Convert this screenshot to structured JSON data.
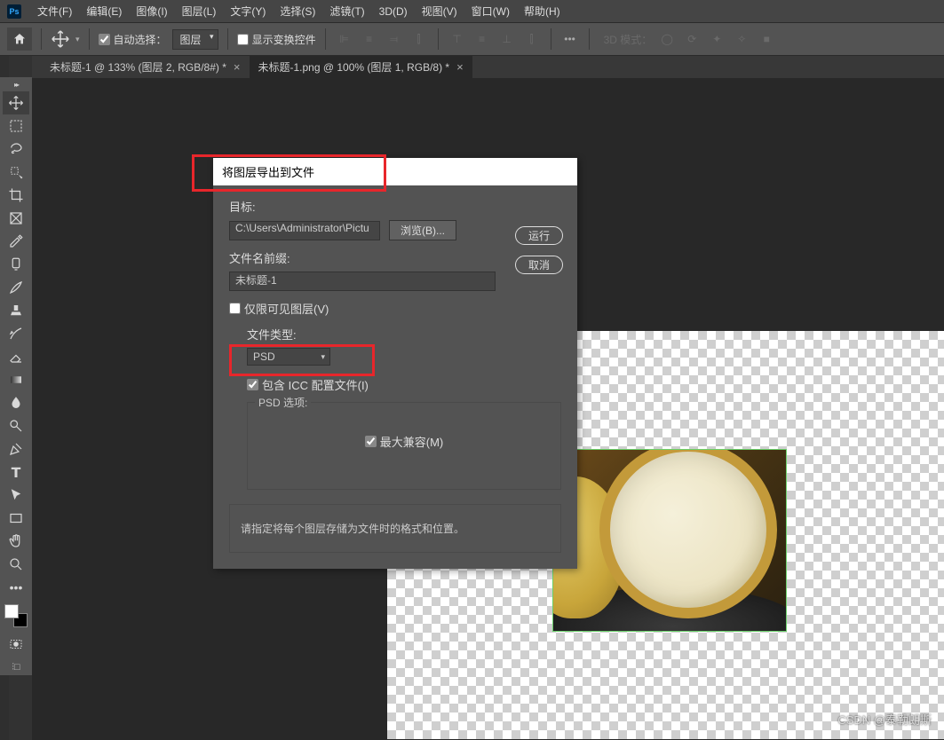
{
  "menubar": {
    "items": [
      "文件(F)",
      "编辑(E)",
      "图像(I)",
      "图层(L)",
      "文字(Y)",
      "选择(S)",
      "滤镜(T)",
      "3D(D)",
      "视图(V)",
      "窗口(W)",
      "帮助(H)"
    ]
  },
  "optbar": {
    "auto_select": "自动选择：",
    "auto_select_value": "图层",
    "show_transform": "显示变换控件",
    "three_d": "3D 模式：",
    "more": "•••"
  },
  "tabs": [
    {
      "label": "未标题-1 @ 133% (图层 2, RGB/8#) *",
      "active": false
    },
    {
      "label": "未标题-1.png @ 100% (图层 1, RGB/8) *",
      "active": true
    }
  ],
  "dialog": {
    "title": "将图层导出到文件",
    "dest_label": "目标:",
    "dest_value": "C:\\Users\\Administrator\\Pictu",
    "browse": "浏览(B)...",
    "run": "运行",
    "cancel": "取消",
    "prefix_label": "文件名前缀:",
    "prefix_value": "未标题-1",
    "visible_only": "仅限可见图层(V)",
    "file_type_label": "文件类型:",
    "file_type_value": "PSD",
    "include_icc": "包含 ICC 配置文件(I)",
    "psd_options": "PSD 选项:",
    "max_compat": "最大兼容(M)",
    "hint": "请指定将每个图层存储为文件时的格式和位置。"
  },
  "watermark": "CSDN @泰勒朗斯"
}
